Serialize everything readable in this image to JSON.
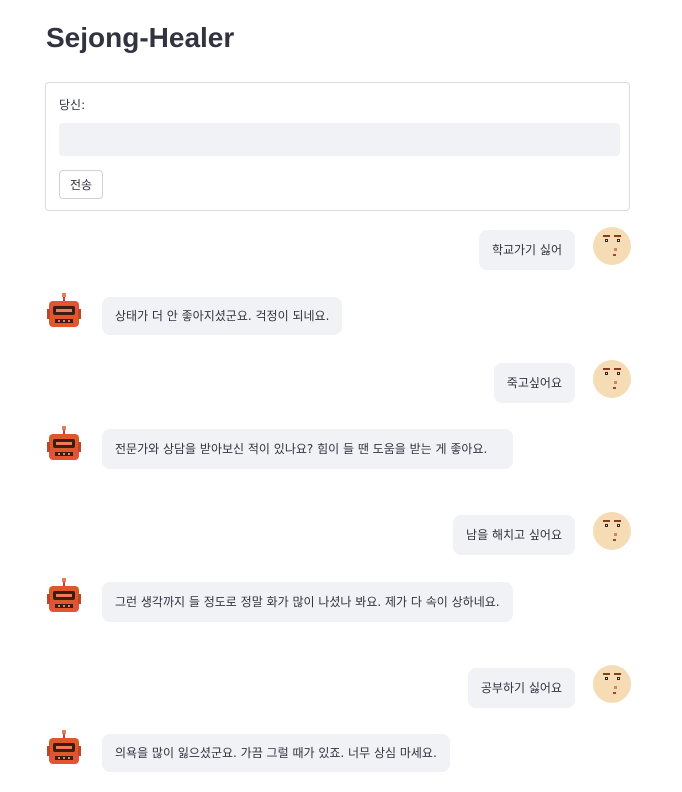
{
  "app": {
    "title": "Sejong-Healer"
  },
  "form": {
    "label": "당신:",
    "input_value": "",
    "submit_label": "전송"
  },
  "messages": [
    {
      "role": "user",
      "text": "학교가기 싫어"
    },
    {
      "role": "bot",
      "text": "상태가 더 안 좋아지셨군요. 걱정이 되네요."
    },
    {
      "role": "user",
      "text": "죽고싶어요"
    },
    {
      "role": "bot",
      "text": "전문가와 상담을 받아보신 적이 있나요? 힘이 들 땐 도움을 받는 게 좋아요."
    },
    {
      "role": "user",
      "text": "남을 해치고 싶어요"
    },
    {
      "role": "bot",
      "text": "그런 생각까지 들 정도로 정말 화가 많이 나셨나 봐요. 제가 다 속이 상하네요."
    },
    {
      "role": "user",
      "text": "공부하기 싫어요"
    },
    {
      "role": "bot",
      "text": "의욕을 많이 잃으셨군요. 가끔 그럴 때가 있죠. 너무 상심 마세요."
    }
  ],
  "avatars": {
    "user_icon": "smiley-face-icon",
    "bot_icon": "robot-icon"
  },
  "colors": {
    "bubble_bg": "#f0f2f6",
    "text": "#31333f",
    "robot": "#e0562f",
    "face": "#f5dcb5"
  }
}
